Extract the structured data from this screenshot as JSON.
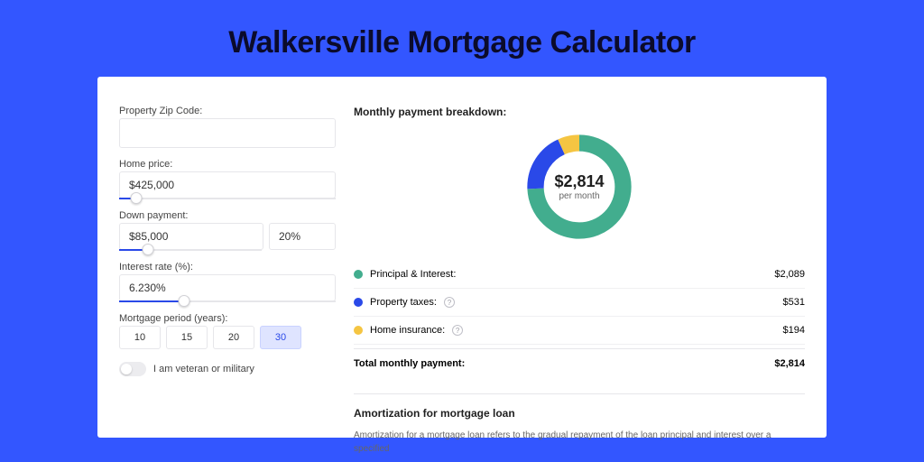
{
  "title": "Walkersville Mortgage Calculator",
  "form": {
    "zip_label": "Property Zip Code:",
    "zip_value": "",
    "price_label": "Home price:",
    "price_value": "$425,000",
    "price_slider_pct": 8,
    "down_label": "Down payment:",
    "down_value": "$85,000",
    "down_pct_value": "20%",
    "down_slider_pct": 20,
    "rate_label": "Interest rate (%):",
    "rate_value": "6.230%",
    "rate_slider_pct": 30,
    "period_label": "Mortgage period (years):",
    "periods": [
      "10",
      "15",
      "20",
      "30"
    ],
    "period_active": 3,
    "veteran_label": "I am veteran or military"
  },
  "breakdown": {
    "title": "Monthly payment breakdown:",
    "total_amount": "$2,814",
    "total_sub": "per month",
    "rows": [
      {
        "label": "Principal & Interest:",
        "value": "$2,089",
        "swatch": "s-green",
        "info": false
      },
      {
        "label": "Property taxes:",
        "value": "$531",
        "swatch": "s-blue",
        "info": true
      },
      {
        "label": "Home insurance:",
        "value": "$194",
        "swatch": "s-yellow",
        "info": true
      }
    ],
    "total_row_label": "Total monthly payment:",
    "total_row_value": "$2,814"
  },
  "chart_data": {
    "type": "pie",
    "title": "Monthly payment breakdown",
    "series": [
      {
        "name": "Principal & Interest",
        "value": 2089,
        "color": "#42ad8e"
      },
      {
        "name": "Property taxes",
        "value": 531,
        "color": "#2a49e8"
      },
      {
        "name": "Home insurance",
        "value": 194,
        "color": "#f5c542"
      }
    ],
    "total": 2814,
    "unit": "USD per month"
  },
  "amort": {
    "title": "Amortization for mortgage loan",
    "body": "Amortization for a mortgage loan refers to the gradual repayment of the loan principal and interest over a specified"
  }
}
